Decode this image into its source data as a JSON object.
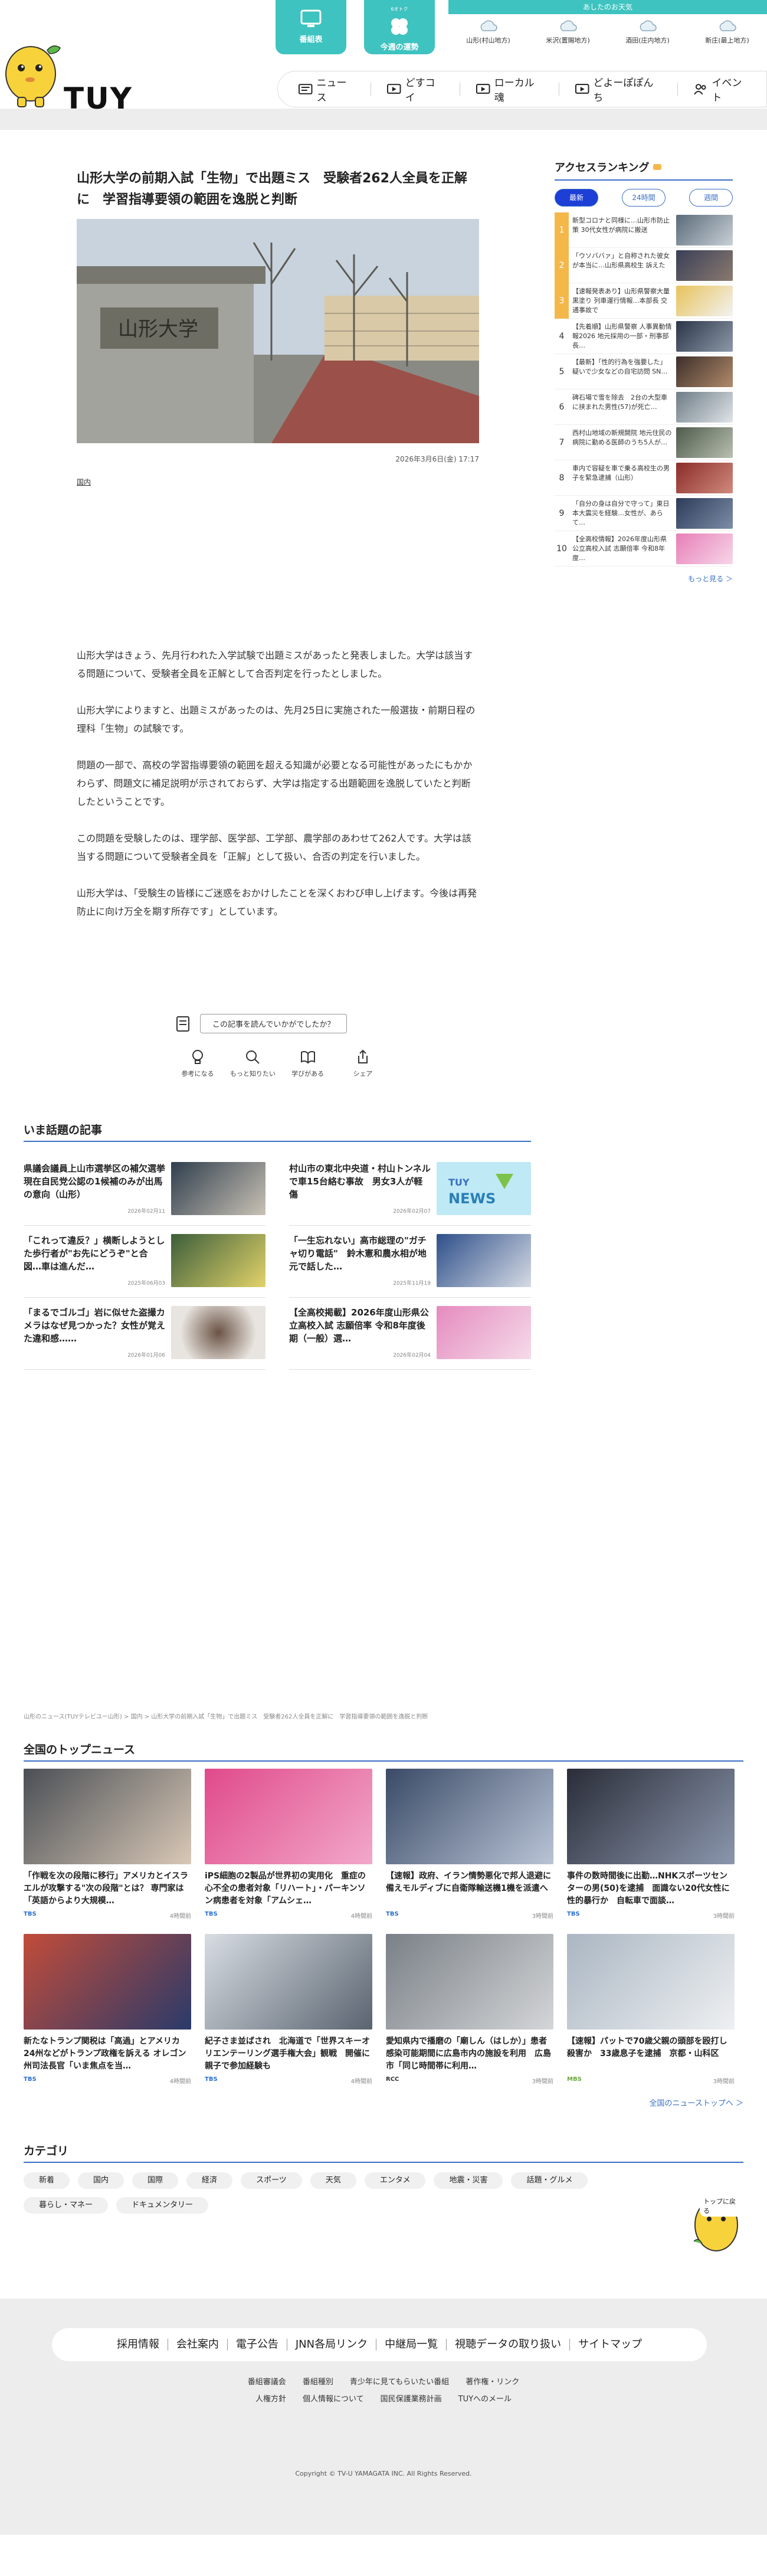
{
  "header": {
    "logo": "TUY",
    "program_button": "番組表",
    "fortune_top": "6オトク",
    "fortune_button": "今週の運勢",
    "weather": {
      "title": "あしたのお天気",
      "cities": [
        "山形(村山地方)",
        "米沢(置賜地方)",
        "酒田(庄内地方)",
        "新庄(最上地方)"
      ]
    },
    "nav": [
      "ニュース",
      "どすコイ",
      "ローカル魂",
      "どよーぽぽんち",
      "イベント"
    ]
  },
  "article": {
    "title": "山形大学の前期入試「生物」で出題ミス　受験者262人全員を正解に　学習指導要領の範囲を逸脱と判断",
    "date": "2026年3月6日(金) 17:17",
    "category": "国内",
    "paragraphs": [
      "山形大学はきょう、先月行われた入学試験で出題ミスがあったと発表しました。大学は該当する問題について、受験者全員を正解として合否判定を行ったとしました。",
      "山形大学によりますと、出題ミスがあったのは、先月25日に実施された一般選抜・前期日程の理科「生物」の試験です。",
      "問題の一部で、高校の学習指導要領の範囲を超える知識が必要となる可能性があったにもかかわらず、問題文に補足説明が示されておらず、大学は指定する出題範囲を逸脱していたと判断したということです。",
      "この問題を受験したのは、理学部、医学部、工学部、農学部のあわせて262人です。大学は該当する問題について受験者全員を「正解」として扱い、合否の判定を行いました。",
      "山形大学は、「受験生の皆様にご迷惑をおかけしたことを深くおわび申し上げます。今後は再発防止に向け万全を期す所存です」としています。"
    ],
    "reaction_question": "この記事を読んでいかがでしたか？",
    "reactions": [
      "参考になる",
      "もっと知りたい",
      "学びがある",
      "シェア"
    ]
  },
  "ranking": {
    "title": "アクセスランキング",
    "tabs": [
      "最新",
      "24時間",
      "週間"
    ],
    "items": [
      {
        "rank": "1",
        "text": "新型コロナと同様に…山形市防止策 30代女性が病院に搬送"
      },
      {
        "rank": "2",
        "text": "「ウソババァ」と自称された彼女が本当に…山形県高校生 訴えた"
      },
      {
        "rank": "3",
        "text": "【速報発表あり】山形県警察大量 黒塗り 列車運行情報…本部長 交通事故で"
      },
      {
        "rank": "4",
        "text": "【先着順】山形県警察 人事異動情報2026 地元採用の一部・刑事部長…"
      },
      {
        "rank": "5",
        "text": "【最新】「性的行為を強要した」疑いで少女などの自宅訪問 SN…"
      },
      {
        "rank": "6",
        "text": "碑石場で雪を除去　2台の大型車に挟まれた男性(57)が死亡…"
      },
      {
        "rank": "7",
        "text": "西村山地域の新規開院 地元住民の病院に勤める医師のうち5人が…"
      },
      {
        "rank": "8",
        "text": "車内で容疑を車で乗る高校生の男子を緊急逮捕（山形）"
      },
      {
        "rank": "9",
        "text": "「自分の身は自分で守って」東日本大震災を経験…女性が、あらて…"
      },
      {
        "rank": "10",
        "text": "【全高校情報】2026年度山形県公立高校入試 志願倍率 今和8年度…"
      }
    ],
    "more": "もっと見る ＞"
  },
  "trending": {
    "title": "いま話題の記事",
    "items": [
      {
        "title": "県議会議員上山市選挙区の補欠選挙　現在自民党公認の1候補のみが出馬の意向（山形）",
        "date": "2026年02月11"
      },
      {
        "title": "村山市の東北中央道・村山トンネルで車15台絡む事故　男女3人が軽傷",
        "date": "2026年02月07"
      },
      {
        "title": "「これって違反？」横断しようとした歩行者が\"お先にどうぞ\"と合図…車は進んだ…",
        "date": "2025年06月03"
      },
      {
        "title": "「一生忘れない」高市総理の\"ガチャ切り電話\"　鈴木憲和農水相が地元で話した…",
        "date": "2025年11月19"
      },
      {
        "title": "「まるでゴルゴ」岩に似せた盗撮カメラはなぜ見つかった？女性が覚えた違和感……",
        "date": "2026年01月06"
      },
      {
        "title": "【全高校掲載】2026年度山形県公立高校入試 志願倍率 令和8年度後期（一般）選…",
        "date": "2026年02月04"
      }
    ]
  },
  "breadcrumb": "山形のニュース(TUYテレビユー山形) > 国内 > 山形大学の前期入試「生物」で出題ミス　受験者262人全員を正解に　学習指導要領の範囲を逸脱と判断",
  "national": {
    "title": "全国のトップニュース",
    "items": [
      {
        "title": "「作戦を次の段階に移行」アメリカとイスラエルが攻撃する\"次の段階\"とは？ 専門家は「英語からより大規模…",
        "source": "TBS",
        "ago": "4時間前"
      },
      {
        "title": "iPS細胞の2製品が世界初の実用化　重症の心不全の患者対象「リハート」・パーキンソン病患者を対象「アムシェ…",
        "source": "TBS",
        "ago": "4時間前"
      },
      {
        "title": "【速報】政府、イラン情勢悪化で邦人退避に備えモルディブに自衛隊輸送機1機を派遣へ",
        "source": "TBS",
        "ago": "3時間前"
      },
      {
        "title": "事件の数時間後に出勤…NHKスポーツセンターの男(50)を逮捕　面識ない20代女性に性的暴行か　自転車で面談…",
        "source": "TBS",
        "ago": "3時間前"
      },
      {
        "title": "新たなトランプ関税は「高過」とアメリカ24州などがトランプ政権を訴える オレゴン州司法長官「いま焦点を当…",
        "source": "TBS",
        "ago": "4時間前"
      },
      {
        "title": "紀子さま並ばされ　北海道で「世界スキーオリエンテーリング選手権大会」観戦　開催に親子で参加経験も",
        "source": "TBS",
        "ago": "4時間前"
      },
      {
        "title": "愛知県内で播磨の「廟しん（はしか）」患者　感染可能期間に広島市内の施設を利用　広島市「同じ時間帯に利用…",
        "source": "RCC",
        "ago": "3時間前"
      },
      {
        "title": "【速報】パットで70歳父親の頭部を殴打し殺害か　33歳息子を逮捕　京都・山科区",
        "source": "MBS",
        "ago": "3時間前"
      }
    ],
    "more": "全国のニューストップへ ＞"
  },
  "categories": {
    "title": "カテゴリ",
    "items": [
      "新着",
      "国内",
      "国際",
      "経済",
      "スポーツ",
      "天気",
      "エンタメ",
      "地震・災害",
      "話題・グルメ",
      "暮らし・マネー",
      "ドキュメンタリー"
    ],
    "to_top": "トップに戻る"
  },
  "footer": {
    "links": [
      "採用情報",
      "会社案内",
      "電子公告",
      "JNN各局リンク",
      "中継局一覧",
      "視聴データの取り扱い",
      "サイトマップ"
    ],
    "sub_row1": [
      "番組審議会",
      "番組種別",
      "青少年に見てもらいたい番組",
      "著作権・リンク"
    ],
    "sub_row2": [
      "人権方針",
      "個人情報について",
      "国民保護業務計画",
      "TUYへのメール"
    ],
    "copyright": "Copyright © TV-U YAMAGATA INC. All Rights Reserved."
  },
  "colors": {
    "teal": "#3ec3c0",
    "blue": "#3a6fc4",
    "active_tab": "#1d3fd6",
    "rank_top": "#f4b74a"
  }
}
